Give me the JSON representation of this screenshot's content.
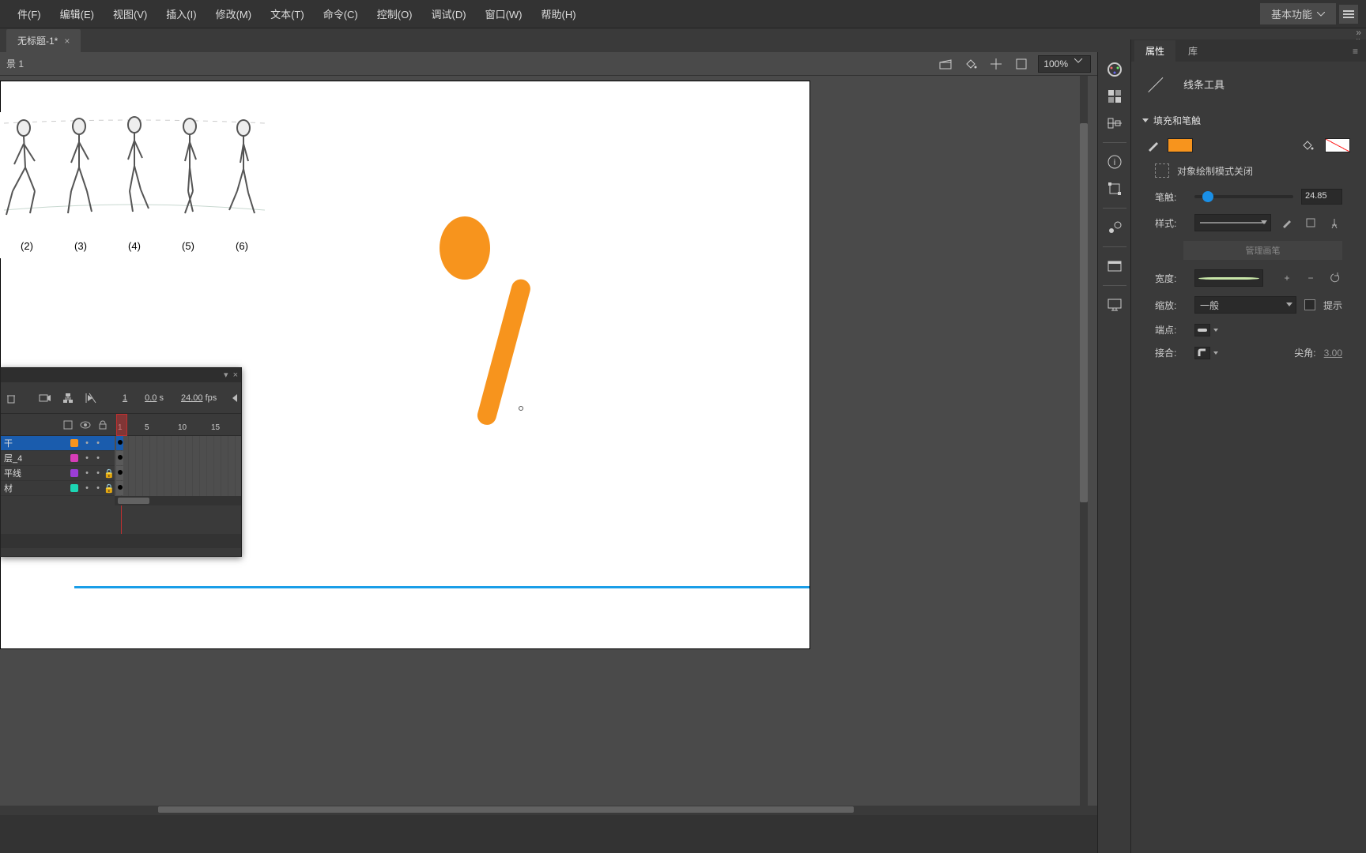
{
  "menu": {
    "items": [
      "件(F)",
      "编辑(E)",
      "视图(V)",
      "插入(I)",
      "修改(M)",
      "文本(T)",
      "命令(C)",
      "控制(O)",
      "调试(D)",
      "窗口(W)",
      "帮助(H)"
    ],
    "workspace": "基本功能"
  },
  "tab": {
    "title": "无标题-1*",
    "close": "×"
  },
  "scene": {
    "crumb": "景 1",
    "zoom": "100%"
  },
  "walk_labels": [
    "(2)",
    "(3)",
    "(4)",
    "(5)",
    "(6)"
  ],
  "timeline": {
    "frame": "1",
    "time": "0.0",
    "time_unit": "s",
    "fps": "24.00",
    "fps_unit": "fps",
    "ruler": [
      "1",
      "5",
      "10",
      "15"
    ],
    "layers": [
      {
        "name": "干",
        "color": "#f7941d",
        "active": true,
        "locked": false
      },
      {
        "name": "层_4",
        "color": "#d63db8",
        "active": false,
        "locked": false
      },
      {
        "name": "平线",
        "color": "#9b3dd6",
        "active": false,
        "locked": true
      },
      {
        "name": "材",
        "color": "#1cd6b4",
        "active": false,
        "locked": true
      }
    ]
  },
  "props": {
    "tabs": [
      "属性",
      "库"
    ],
    "tool_name": "线条工具",
    "section_fill": "填充和笔触",
    "fill_color": "#f7941d",
    "obj_draw": "对象绘制模式关闭",
    "stroke_label": "笔触:",
    "stroke_value": "24.85",
    "stroke_slider_pct": 8,
    "style_label": "样式:",
    "manage_brush": "管理画笔",
    "width_label": "宽度:",
    "scale_label": "缩放:",
    "scale_value": "一般",
    "hint_label": "提示",
    "cap_label": "端点:",
    "join_label": "接合:",
    "miter_label": "尖角:",
    "miter_value": "3.00"
  }
}
